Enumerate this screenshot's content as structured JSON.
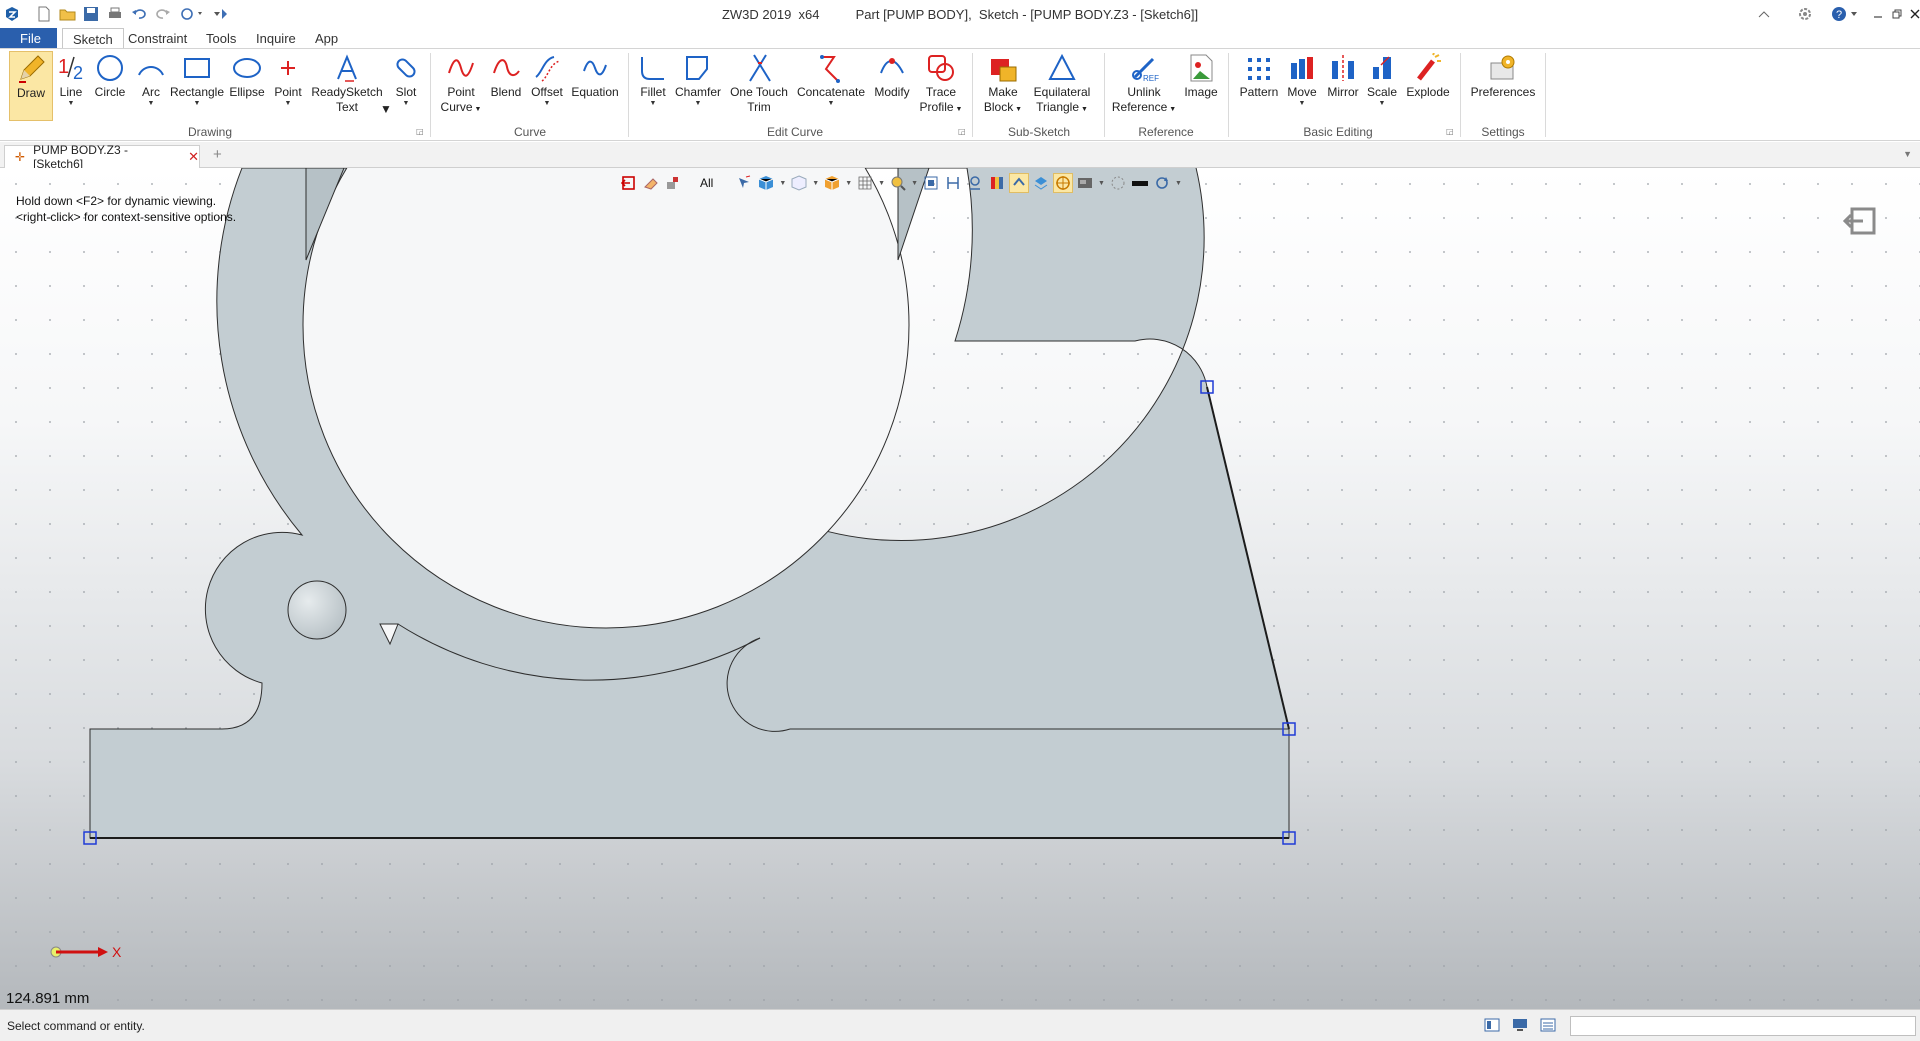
{
  "titlebar": {
    "app": "ZW3D 2019  x64",
    "doc": "Part [PUMP BODY],  Sketch - [PUMP BODY.Z3 - [Sketch6]]"
  },
  "menu": {
    "file": "File",
    "tabs": [
      "Sketch",
      "Constraint",
      "Tools",
      "Inquire",
      "App"
    ]
  },
  "ribbon": {
    "groups": {
      "drawing": "Drawing",
      "curve": "Curve",
      "edit_curve": "Edit Curve",
      "sub_sketch": "Sub-Sketch",
      "reference": "Reference",
      "basic_editing": "Basic Editing",
      "settings": "Settings"
    },
    "buttons": {
      "draw": "Draw",
      "line": "Line",
      "circle": "Circle",
      "arc": "Arc",
      "rectangle": "Rectangle",
      "ellipse": "Ellipse",
      "point": "Point",
      "readysketch_1": "ReadySketch",
      "readysketch_2": "Text",
      "slot": "Slot",
      "point_curve_1": "Point",
      "point_curve_2": "Curve",
      "blend": "Blend",
      "offset": "Offset",
      "equation": "Equation",
      "fillet": "Fillet",
      "chamfer": "Chamfer",
      "one_touch_1": "One Touch",
      "one_touch_2": "Trim",
      "concatenate": "Concatenate",
      "modify": "Modify",
      "trace_1": "Trace",
      "trace_2": "Profile",
      "make_block_1": "Make",
      "make_block_2": "Block",
      "equilateral_1": "Equilateral",
      "equilateral_2": "Triangle",
      "unlink_1": "Unlink",
      "unlink_2": "Reference",
      "image": "Image",
      "pattern": "Pattern",
      "move": "Move",
      "mirror": "Mirror",
      "scale": "Scale",
      "explode": "Explode",
      "preferences": "Preferences"
    }
  },
  "doc_tab": {
    "label": "PUMP BODY.Z3 - [Sketch6]"
  },
  "viewport": {
    "hint_line1": "Hold down <F2> for dynamic viewing.",
    "hint_line2": "<right-click> for context-sensitive options.",
    "filter": "All",
    "axis_x": "X",
    "measurement": "124.891 mm"
  },
  "status": {
    "message": "Select command or entity."
  },
  "colors": {
    "accent": "#2a5fad",
    "part_fill": "#c3cdd2",
    "handle": "#1f3bd6",
    "selected": "#fbe7a4"
  }
}
